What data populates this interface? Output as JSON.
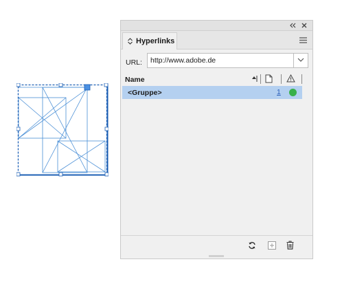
{
  "panel": {
    "title": "Hyperlinks",
    "url_label": "URL:",
    "url_value": "http://www.adobe.de",
    "column_name": "Name",
    "rows": [
      {
        "name": "<Gruppe>",
        "page": "1",
        "status": "ok"
      }
    ],
    "status_color": "#38b04a",
    "selection_color": "#b4d0f0",
    "accent_color": "#4a90e2"
  },
  "icons": {
    "collapse": "double-chevron-left-icon",
    "close": "close-icon",
    "tab_arrows": "up-down-arrows-icon",
    "menu": "panel-menu-icon",
    "dropdown": "chevron-down-icon",
    "sort": "sort-ascending-icon",
    "page": "page-icon",
    "warning": "warning-icon",
    "refresh": "refresh-icon",
    "new": "new-hyperlink-icon",
    "trash": "trash-icon"
  }
}
